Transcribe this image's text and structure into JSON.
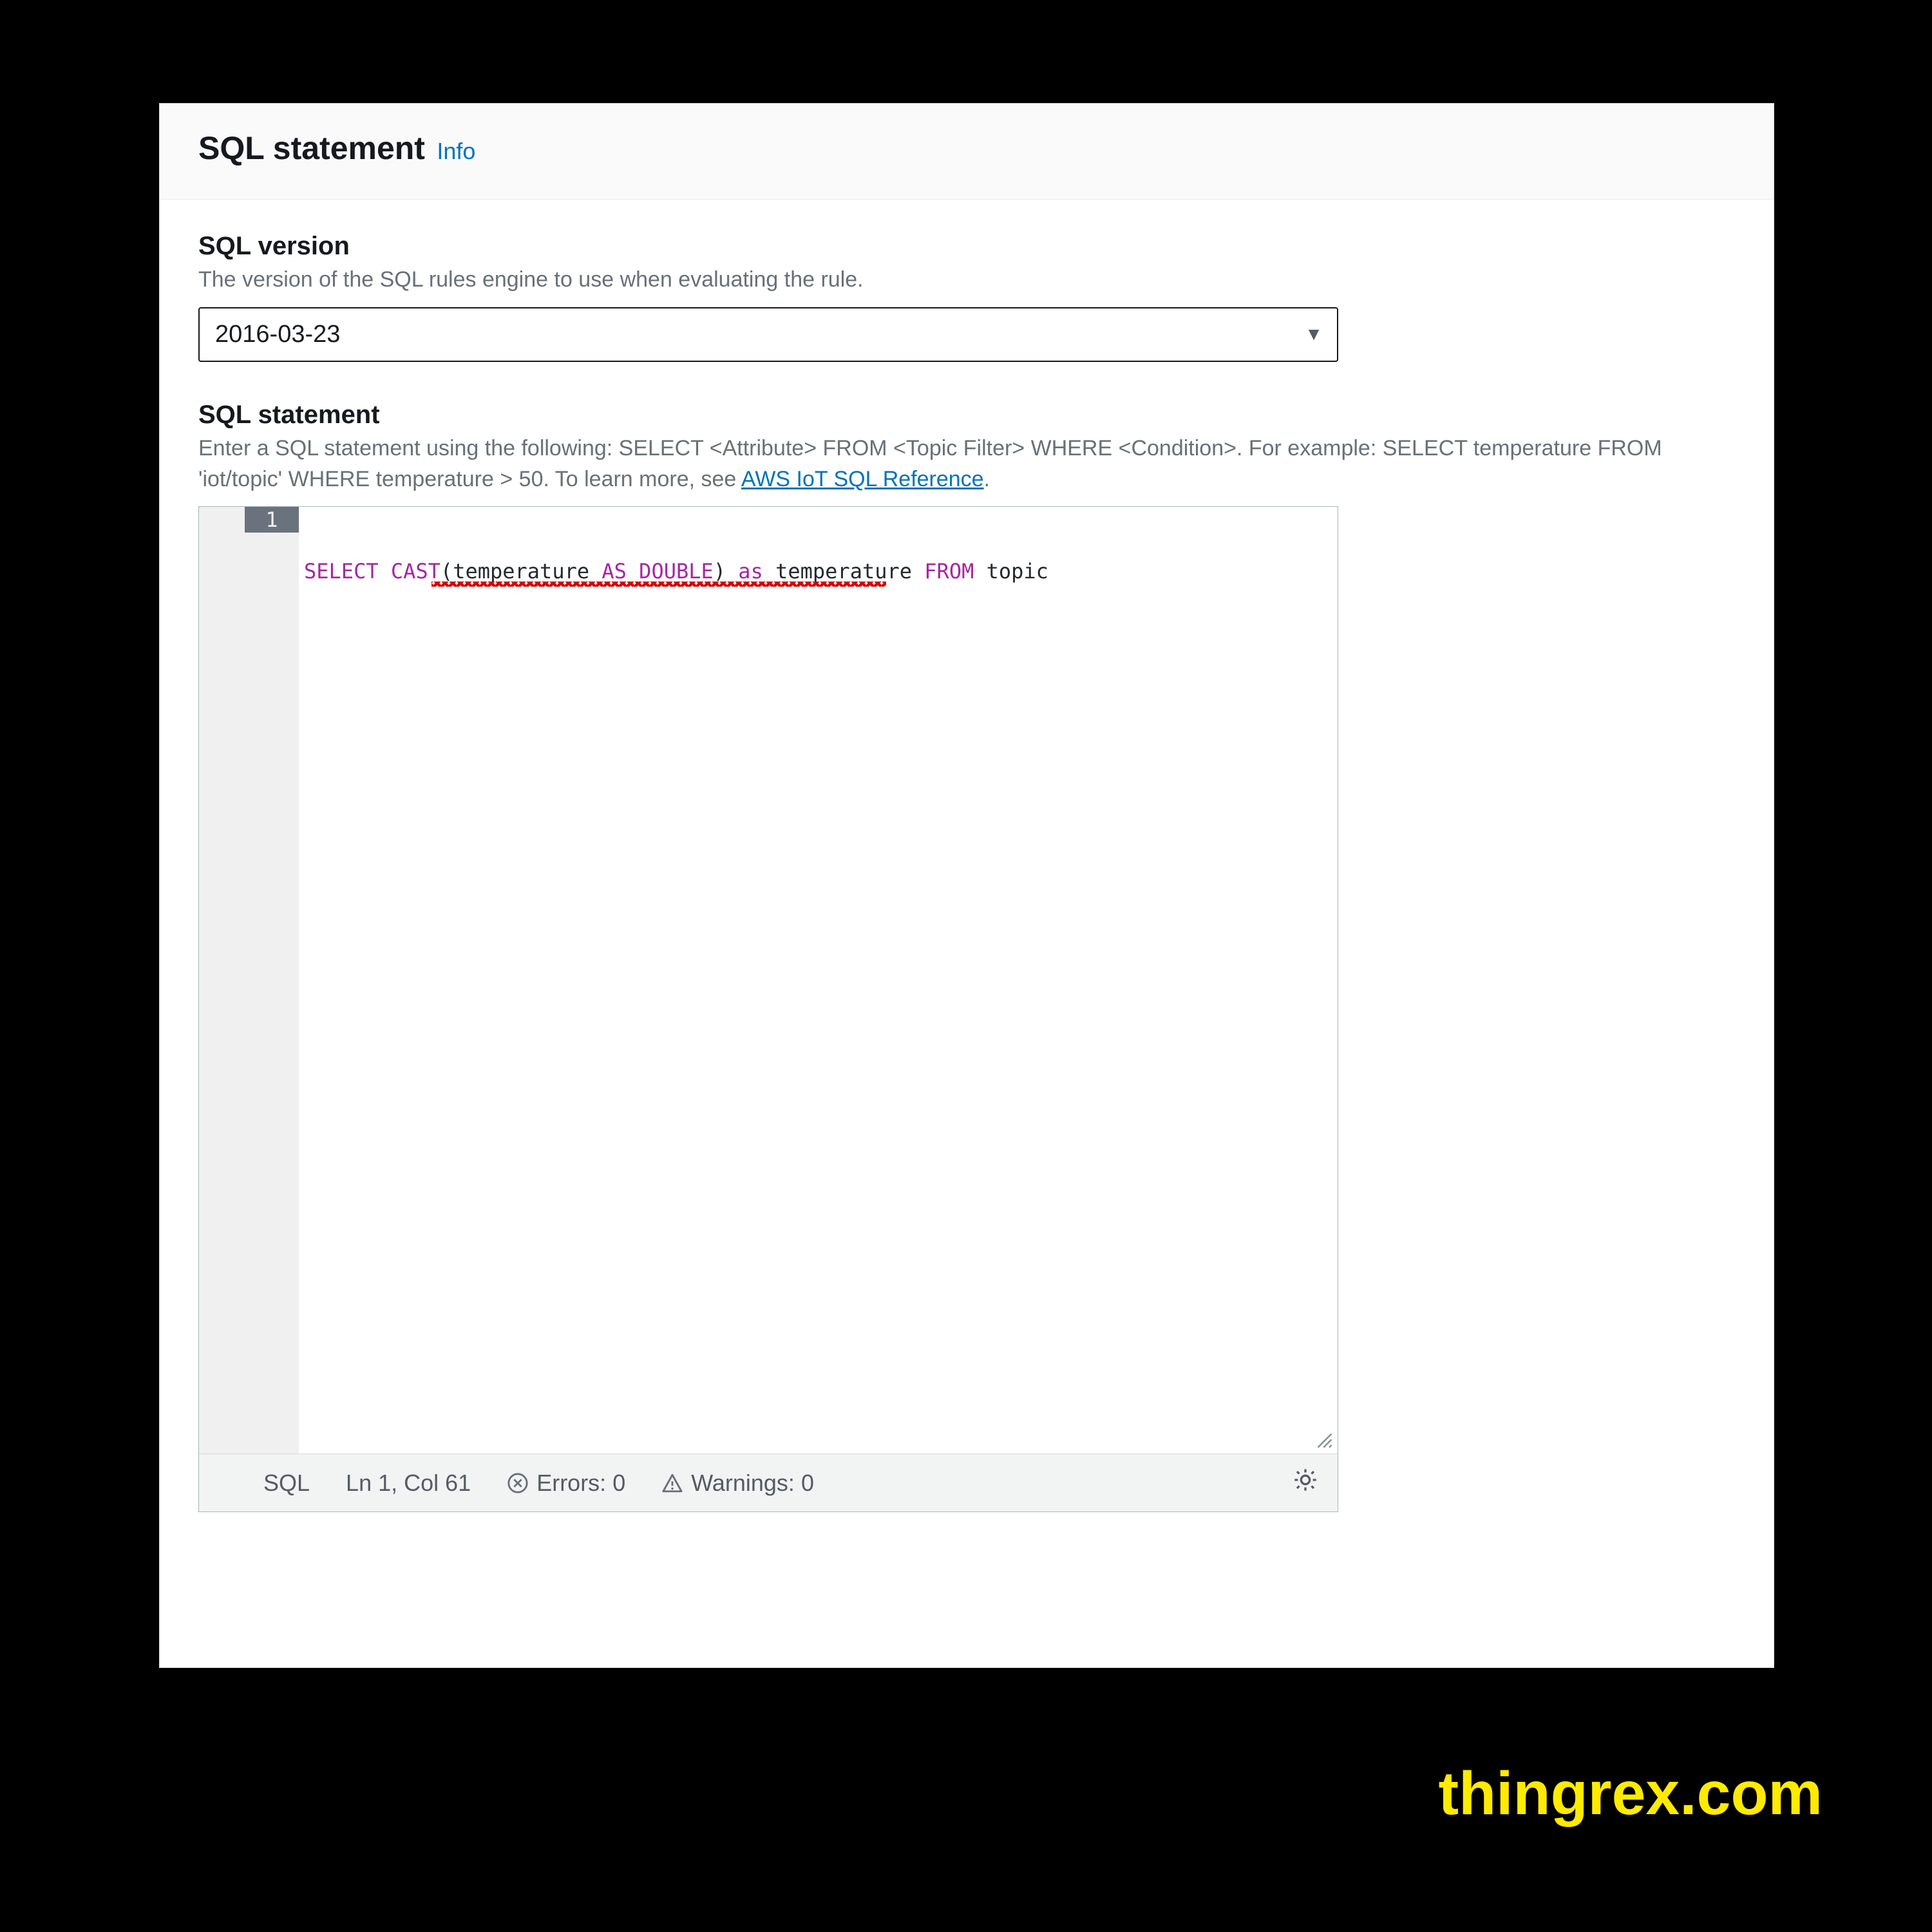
{
  "header": {
    "title": "SQL statement",
    "info_label": "Info"
  },
  "sql_version": {
    "label": "SQL version",
    "help": "The version of the SQL rules engine to use when evaluating the rule.",
    "selected": "2016-03-23"
  },
  "sql_statement": {
    "label": "SQL statement",
    "help_prefix": "Enter a SQL statement using the following: SELECT <Attribute> FROM <Topic Filter> WHERE <Condition>. For example: SELECT temperature FROM 'iot/topic' WHERE temperature > 50. To learn more, see ",
    "help_link_text": "AWS IoT SQL Reference",
    "help_suffix": ".",
    "code_tokens": {
      "select": "SELECT",
      "cast": "CAST",
      "lp": "(",
      "temperature1": "temperature",
      "as_kw": "AS",
      "double_kw": "DOUBLE",
      "rp": ")",
      "as_alias": "as",
      "temperature2": "temperature",
      "from_kw": "FROM",
      "topic": "topic"
    },
    "line_number": "1"
  },
  "status": {
    "lang": "SQL",
    "position": "Ln 1, Col 61",
    "errors": "Errors: 0",
    "warnings": "Warnings: 0"
  },
  "watermark": "thingrex.com"
}
